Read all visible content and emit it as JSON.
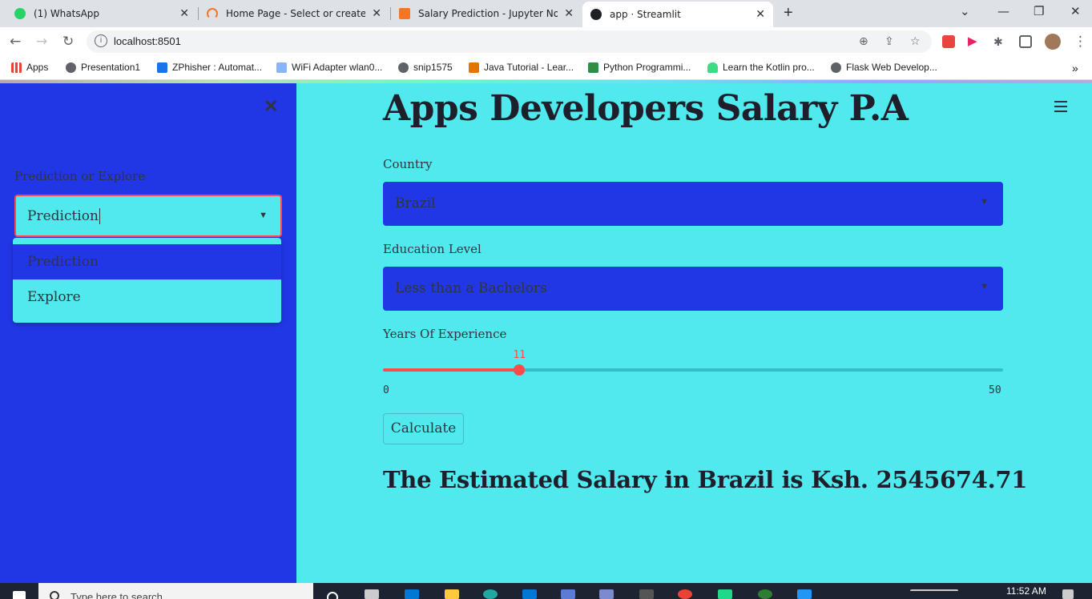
{
  "browser": {
    "tabs": [
      {
        "title": "(1) WhatsApp",
        "icon": "whatsapp-icon",
        "color": "#25d366"
      },
      {
        "title": "Home Page - Select or create a n",
        "icon": "jupyter-icon",
        "color": "#f37626"
      },
      {
        "title": "Salary Prediction - Jupyter Noteb",
        "icon": "notebook-icon",
        "color": "#f37626"
      },
      {
        "title": "app · Streamlit",
        "icon": "streamlit-icon",
        "color": "#202124"
      }
    ],
    "new_tab": "+",
    "url": "localhost:8501",
    "bookmarks": [
      {
        "label": "Apps",
        "icon": "apps-grid-icon"
      },
      {
        "label": "Presentation1",
        "icon": "globe-icon"
      },
      {
        "label": "ZPhisher : Automat...",
        "icon": "zphisher-icon"
      },
      {
        "label": "WiFi Adapter wlan0...",
        "icon": "wifi-icon"
      },
      {
        "label": "snip1575",
        "icon": "globe-icon"
      },
      {
        "label": "Java Tutorial - Lear...",
        "icon": "java-icon"
      },
      {
        "label": "Python Programmi...",
        "icon": "geeks-icon"
      },
      {
        "label": "Learn the Kotlin pro...",
        "icon": "android-icon"
      },
      {
        "label": "Flask Web Develop...",
        "icon": "globe-icon"
      }
    ],
    "more_bookmarks": "»"
  },
  "sidebar": {
    "label": "Prediction or Explore",
    "selected": "Prediction",
    "options": [
      "Prediction",
      "Explore"
    ]
  },
  "main": {
    "title": "Apps Developers Salary P.A",
    "country": {
      "label": "Country",
      "value": "Brazil"
    },
    "education": {
      "label": "Education Level",
      "value": "Less than a Bachelors"
    },
    "experience": {
      "label": "Years Of Experience",
      "value": 11,
      "min": 0,
      "max": 50,
      "value_text": "11",
      "min_text": "0",
      "max_text": "50"
    },
    "calculate_label": "Calculate",
    "result": "The Estimated Salary in Brazil is Ksh. 2545674.71"
  },
  "taskbar": {
    "search_placeholder": "Type here to search",
    "time": "11:52 AM"
  },
  "colors": {
    "sidebar_bg": "#2137e6",
    "main_bg": "#50e9ee",
    "accent": "#ff4b4b",
    "select_bg": "#2137e6"
  }
}
